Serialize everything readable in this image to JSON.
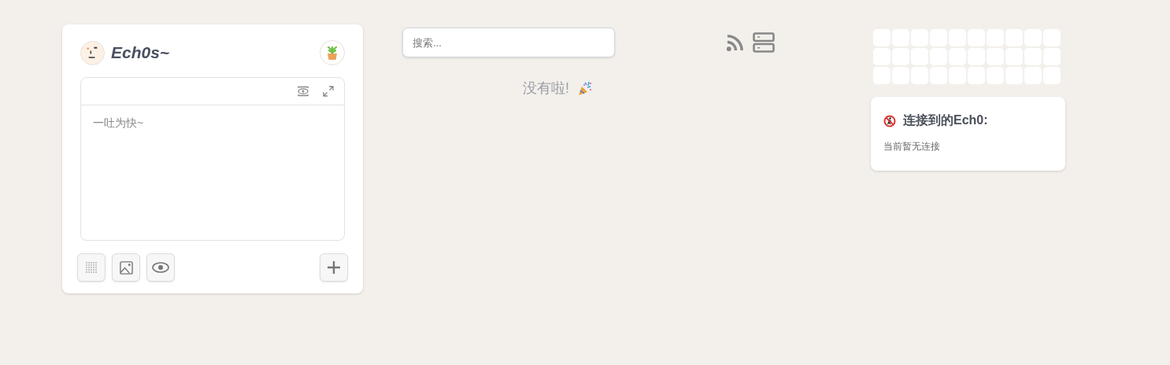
{
  "profile": {
    "name": "Ech0s~"
  },
  "editor": {
    "placeholder": "一吐为快~"
  },
  "search": {
    "placeholder": "搜索..."
  },
  "feed": {
    "end_message": "没有啦!"
  },
  "connections": {
    "title": "连接到的Ech0:",
    "empty_message": "当前暂无连接"
  }
}
